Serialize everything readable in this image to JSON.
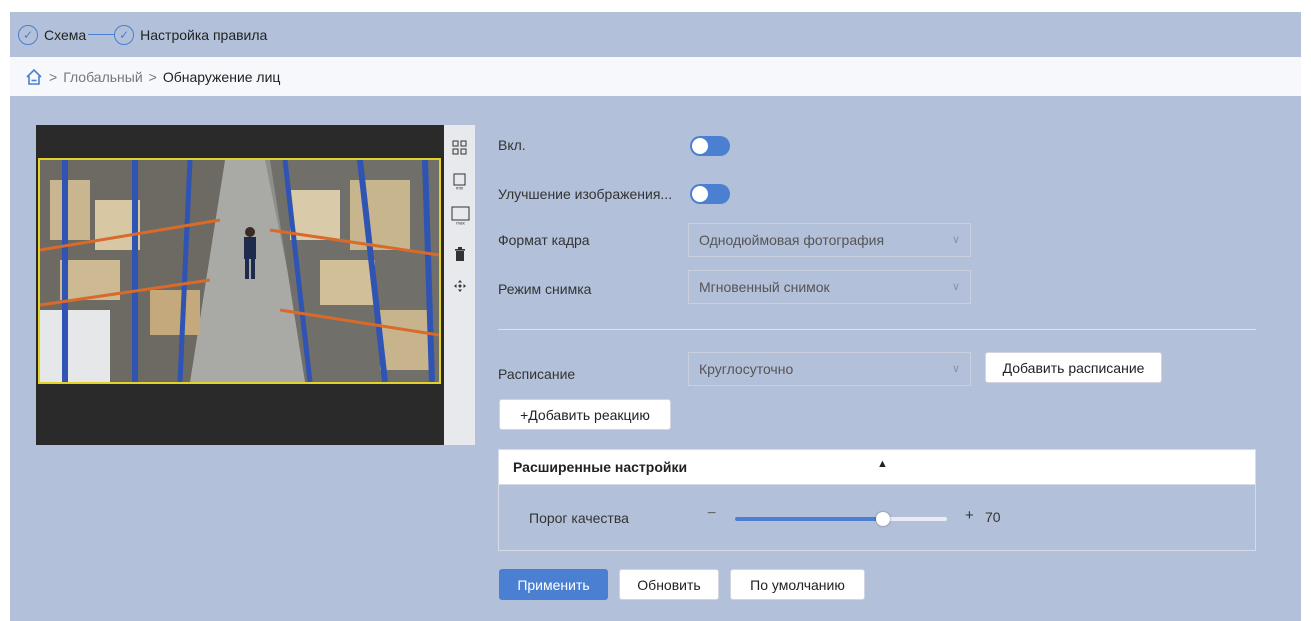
{
  "steps": [
    {
      "label": "Схема"
    },
    {
      "label": "Настройка правила"
    }
  ],
  "breadcrumb": {
    "sep": ">",
    "global": "Глобальный",
    "current": "Обнаружение лиц"
  },
  "tools": [
    "grid-icon",
    "min-box-icon",
    "max-box-icon",
    "trash-icon",
    "move-icon"
  ],
  "tool_labels": {
    "min": "min",
    "max": "max"
  },
  "form": {
    "enable_label": "Вкл.",
    "enable_on": false,
    "enhance_label": "Улучшение изображения...",
    "enhance_on": false,
    "frame_label": "Формат кадра",
    "frame_value": "Однодюймовая фотография",
    "mode_label": "Режим снимка",
    "mode_value": "Мгновенный снимок",
    "schedule_label": "Расписание",
    "schedule_value": "Круглосуточно",
    "add_schedule": "Добавить расписание",
    "add_reaction": "+Добавить реакцию"
  },
  "advanced": {
    "title": "Расширенные настройки",
    "slider_label": "Порог качества",
    "minus": "−",
    "plus": "+",
    "value": "70",
    "fraction": 0.7
  },
  "actions": {
    "apply": "Применить",
    "refresh": "Обновить",
    "default": "По умолчанию"
  },
  "colors": {
    "accent": "#4a7fd1",
    "background": "#b3c0d9",
    "roi_border": "#e3d22a"
  }
}
